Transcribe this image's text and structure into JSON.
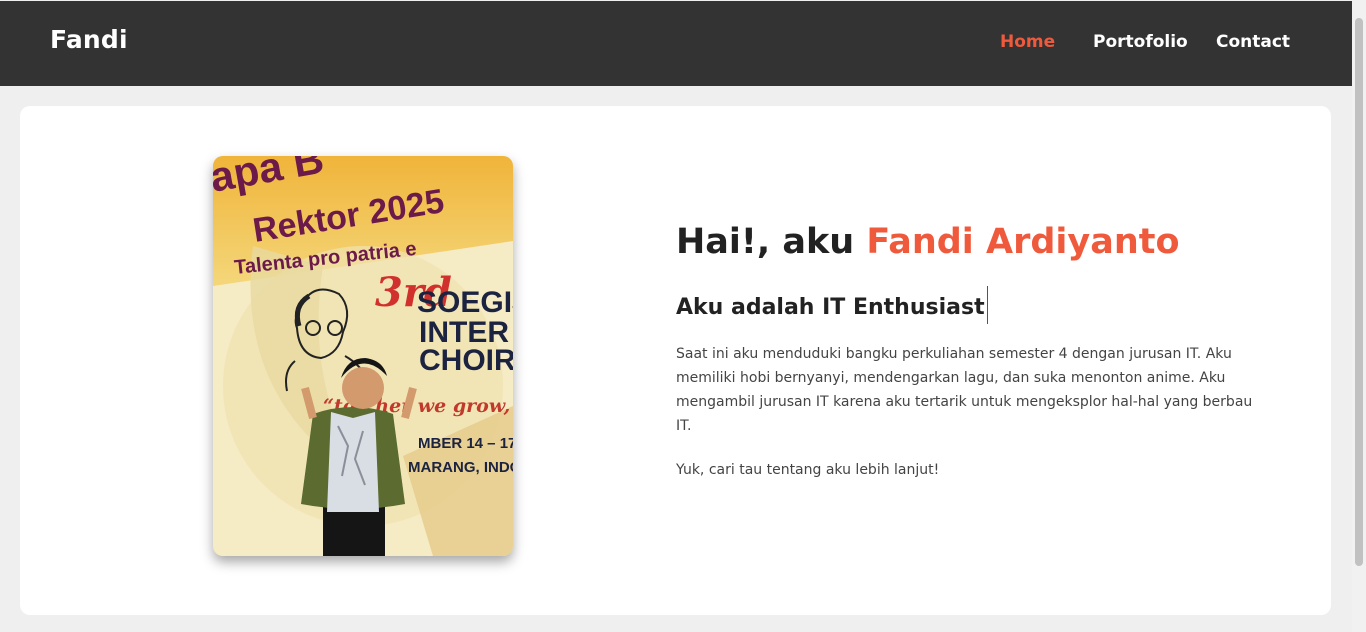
{
  "navbar": {
    "brand": "Fandi",
    "links": [
      {
        "label": "Home",
        "active": true
      },
      {
        "label": "Portofolio",
        "active": false
      },
      {
        "label": "Contact",
        "active": false
      }
    ]
  },
  "colors": {
    "navbar_bg": "#333333",
    "accent": "#f05a3c",
    "page_bg": "#efefef",
    "card_bg": "#ffffff",
    "text_dark": "#222222"
  },
  "hero": {
    "photo_alt": "Fandi at Soegijapranata International Choir Competition",
    "photo_banner": {
      "line1": "apa B",
      "line2": "Rektor 2025",
      "line3": "Talenta pro patria e",
      "ordinal": "3rd",
      "event1": "SOEGIJ",
      "event2": "INTER",
      "event3": "CHOIR C",
      "slogan": "“tog   her we grow, uni",
      "date": "MBER 14 – 17,",
      "place": "MARANG, INDON"
    },
    "greeting_prefix": "Hai!, aku ",
    "greeting_name": "Fandi Ardiyanto",
    "role": "Aku adalah IT Enthusiast",
    "description": "Saat ini aku menduduki bangku perkuliahan semester 4 dengan jurusan IT. Aku memiliki hobi bernyanyi, mendengarkan lagu, dan suka menonton anime. Aku mengambil jurusan IT karena aku tertarik untuk mengeksplor hal-hal yang berbau IT.",
    "cta": "Yuk, cari tau tentang aku lebih lanjut!"
  }
}
